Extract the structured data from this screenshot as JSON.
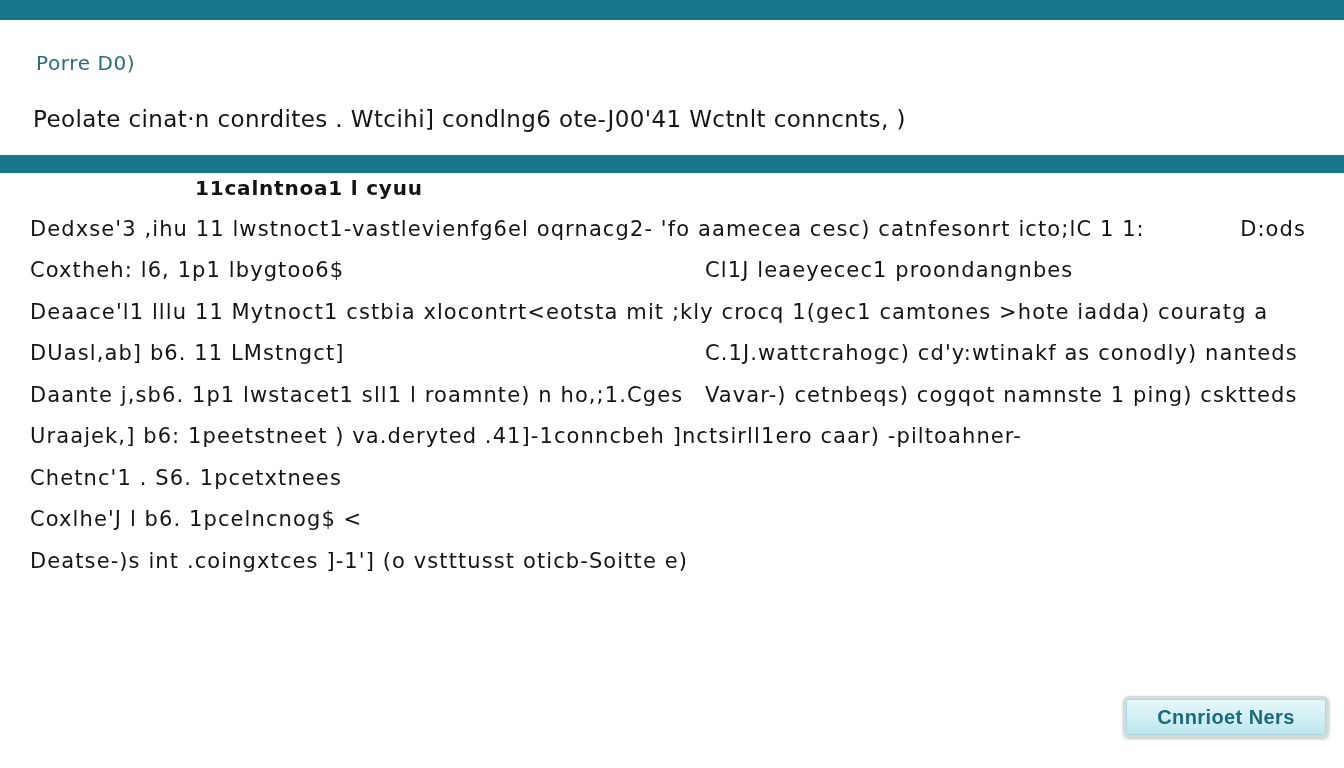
{
  "header": {
    "title": "Porre D0)",
    "subtitle": "Peolate cinat·n conrdites . Wtcihi] condlng6 ote-J00'41 Wctnlt conncnts, )"
  },
  "list": {
    "heading": "11calntnoa1 l cyuu",
    "rows": [
      {
        "kind": "wide",
        "text": "Dedxse'3 ,ihu 11 lwstnoct1-vastlevienfg6el oqrnacg2- 'fo aamecea cesc) catnfesonrt icto;lC 1 1:",
        "note": "D:ods"
      },
      {
        "kind": "split",
        "text": "Coxtheh: l6, 1p1 lbygtoo6$",
        "detail": "Cl1J leaeyecec1 proondangnbes"
      },
      {
        "kind": "wide",
        "text": "Deaace'l1 lllu 11 Mytnoct1 cstbia xlocontrt<eotsta mit ;kly crocq 1(gec1 camtones >hote iadda) couratg a"
      },
      {
        "kind": "split",
        "text": "DUasl,ab] b6. 11 LMstngct]",
        "detail": "C.1J.wattcrahogc) cd'y:wtinakf as conodly) nanteds"
      },
      {
        "kind": "split",
        "text": "Daante j,sb6. 1p1 lwstacet1 sll1 l roamnte) n ho,;1.Cges",
        "detail": "Vavar-) cetnbeqs) cogqot namnste 1 ping) csktteds"
      },
      {
        "kind": "wide",
        "text": "Uraajek,] b6: 1peetstneet ) va.deryted .41]-1conncbeh ]nctsirll1ero caar) -piltoahner-"
      },
      {
        "kind": "wide",
        "text": "Chetnc'1 . S6. 1pcetxtnees"
      },
      {
        "kind": "wide",
        "text": "Coxlhe'J l b6. 1pcelncnog$ <"
      },
      {
        "kind": "wide",
        "text": "Deatse-)s int .coingxtces ]-1'] (o vstttusst oticb-Soitte e)"
      }
    ]
  },
  "button": {
    "label": "Cnnrioet Ners"
  }
}
